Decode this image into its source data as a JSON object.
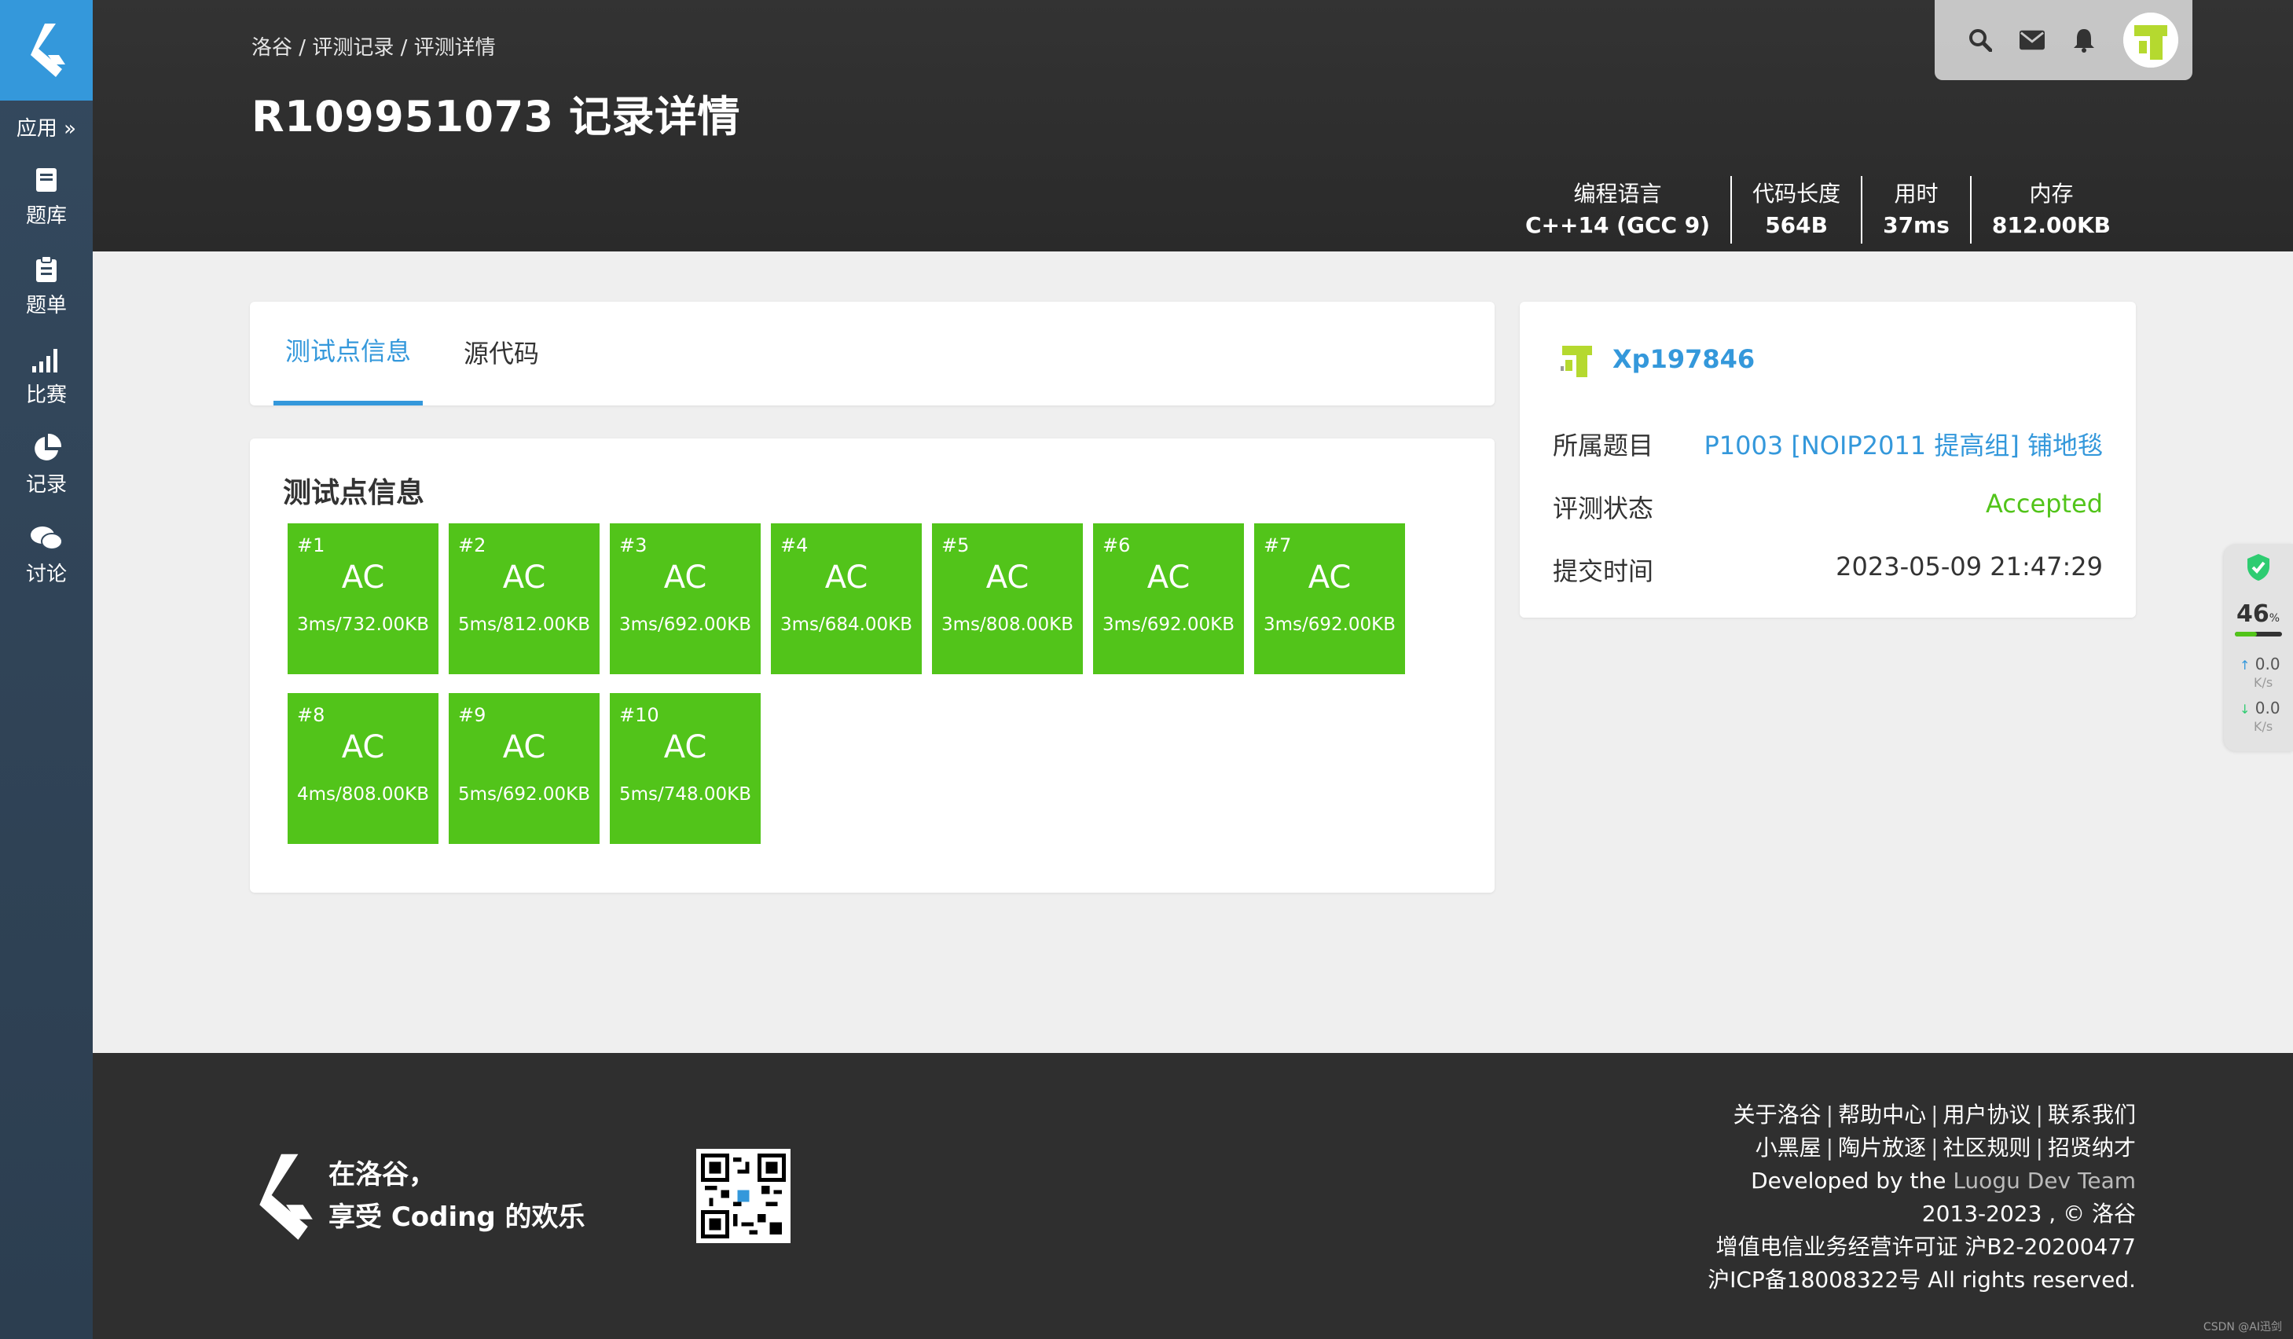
{
  "sidebar": {
    "apps_label": "应用 »",
    "items": [
      {
        "label": "题库",
        "icon": "book-icon"
      },
      {
        "label": "题单",
        "icon": "clipboard-icon"
      },
      {
        "label": "比赛",
        "icon": "bar-chart-icon"
      },
      {
        "label": "记录",
        "icon": "pie-chart-icon"
      },
      {
        "label": "讨论",
        "icon": "comments-icon"
      }
    ]
  },
  "header": {
    "breadcrumb": [
      "洛谷",
      "评测记录",
      "评测详情"
    ],
    "breadcrumb_sep": " / ",
    "title": "R109951073 记录详情",
    "stats": [
      {
        "label": "编程语言",
        "value": "C++14 (GCC 9)"
      },
      {
        "label": "代码长度",
        "value": "564B"
      },
      {
        "label": "用时",
        "value": "37ms"
      },
      {
        "label": "内存",
        "value": "812.00KB"
      }
    ]
  },
  "tabs": [
    {
      "label": "测试点信息",
      "active": true
    },
    {
      "label": "源代码",
      "active": false
    }
  ],
  "tests": {
    "title": "测试点信息",
    "cases": [
      {
        "id": "#1",
        "status": "AC",
        "info": "3ms/732.00KB"
      },
      {
        "id": "#2",
        "status": "AC",
        "info": "5ms/812.00KB"
      },
      {
        "id": "#3",
        "status": "AC",
        "info": "3ms/692.00KB"
      },
      {
        "id": "#4",
        "status": "AC",
        "info": "3ms/684.00KB"
      },
      {
        "id": "#5",
        "status": "AC",
        "info": "3ms/808.00KB"
      },
      {
        "id": "#6",
        "status": "AC",
        "info": "3ms/692.00KB"
      },
      {
        "id": "#7",
        "status": "AC",
        "info": "3ms/692.00KB"
      },
      {
        "id": "#8",
        "status": "AC",
        "info": "4ms/808.00KB"
      },
      {
        "id": "#9",
        "status": "AC",
        "info": "5ms/692.00KB"
      },
      {
        "id": "#10",
        "status": "AC",
        "info": "5ms/748.00KB"
      }
    ],
    "ac_color": "#52c41a"
  },
  "record": {
    "user": "Xp197846",
    "problem_label": "所属题目",
    "problem_value": "P1003 [NOIP2011 提高组] 铺地毯",
    "status_label": "评测状态",
    "status_value": "Accepted",
    "time_label": "提交时间",
    "time_value": "2023-05-09 21:47:29"
  },
  "widget": {
    "percent": "46",
    "percent_unit": "%",
    "up_speed": "0.0",
    "down_speed": "0.0",
    "speed_unit": "K/s",
    "level": 0.46
  },
  "footer": {
    "slogan_line1": "在洛谷，",
    "slogan_line2": "享受 Coding 的欢乐",
    "links_row1": [
      "关于洛谷",
      "帮助中心",
      "用户协议",
      "联系我们"
    ],
    "links_row2": [
      "小黑屋",
      "陶片放逐",
      "社区规则",
      "招贤纳才"
    ],
    "developed_prefix": "Developed by the ",
    "developed_team": "Luogu Dev Team",
    "copyright": "2013-2023 , © 洛谷",
    "license": "增值电信业务经营许可证 沪B2-20200477",
    "icp": "沪ICP备18008322号 All rights reserved."
  },
  "watermark": "CSDN @AI迅剑",
  "colors": {
    "accent": "#3498db",
    "success": "#52c41a",
    "header_bg": "#2f2f2f"
  }
}
